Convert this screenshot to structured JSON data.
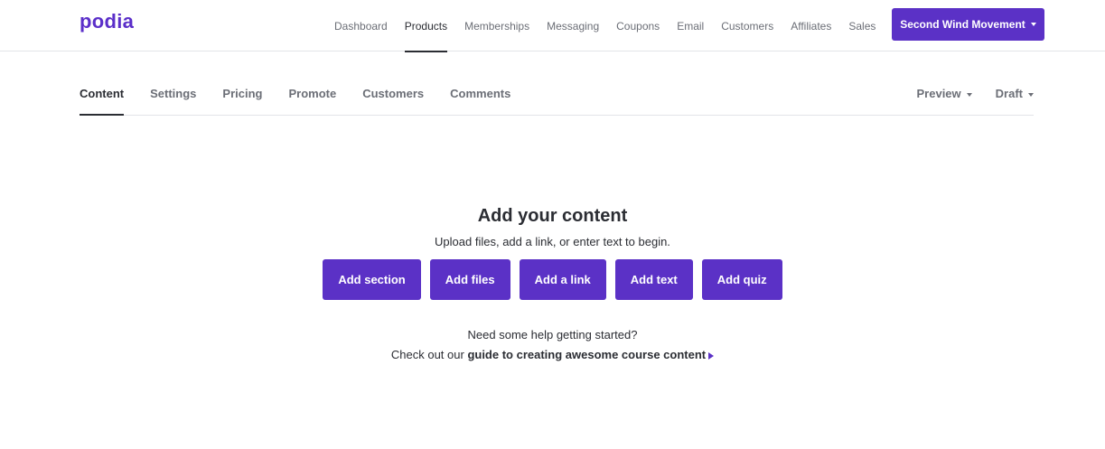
{
  "brand": {
    "logo_text": "podia",
    "accent_color": "#5b31c6"
  },
  "top_nav": {
    "items": [
      {
        "label": "Dashboard"
      },
      {
        "label": "Products"
      },
      {
        "label": "Memberships"
      },
      {
        "label": "Messaging"
      },
      {
        "label": "Coupons"
      },
      {
        "label": "Email"
      },
      {
        "label": "Customers"
      },
      {
        "label": "Affiliates"
      },
      {
        "label": "Sales"
      }
    ],
    "active": "Products",
    "account_button": "Second Wind Movement"
  },
  "product_tabs": {
    "items": [
      {
        "label": "Content"
      },
      {
        "label": "Settings"
      },
      {
        "label": "Pricing"
      },
      {
        "label": "Promote"
      },
      {
        "label": "Customers"
      },
      {
        "label": "Comments"
      }
    ],
    "active": "Content",
    "preview_label": "Preview",
    "status_label": "Draft"
  },
  "empty_state": {
    "title": "Add your content",
    "subtitle": "Upload files, add a link, or enter text to begin.",
    "buttons": [
      {
        "label": "Add section"
      },
      {
        "label": "Add files"
      },
      {
        "label": "Add a link"
      },
      {
        "label": "Add text"
      },
      {
        "label": "Add quiz"
      }
    ],
    "help_line1": "Need some help getting started?",
    "help_prefix": "Check out our",
    "help_link": "guide to creating awesome course content"
  }
}
